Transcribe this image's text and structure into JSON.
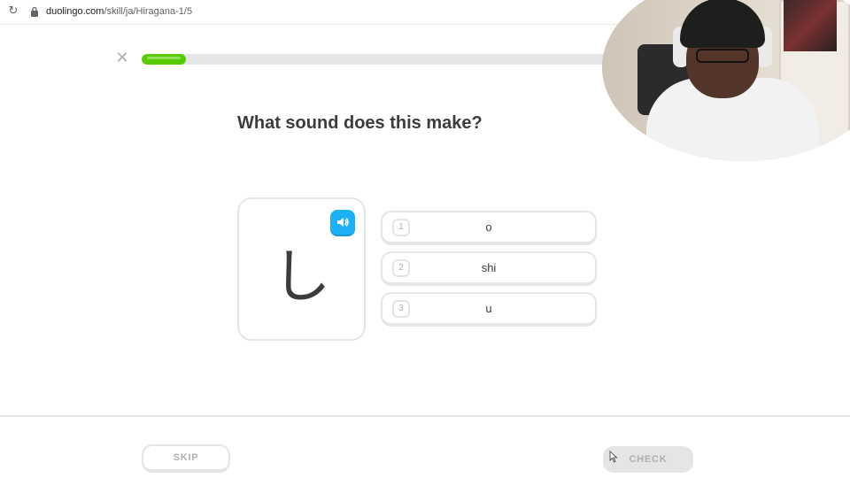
{
  "browser": {
    "url_host": "duolingo.com",
    "url_path": "/skill/ja/Hiragana-1/5"
  },
  "lesson": {
    "progress": 0.09,
    "question": "What sound does this make?",
    "character": "し",
    "options": [
      {
        "num": "1",
        "label": "o"
      },
      {
        "num": "2",
        "label": "shi"
      },
      {
        "num": "3",
        "label": "u"
      }
    ]
  },
  "footer": {
    "skip_label": "SKIP",
    "check_label": "CHECK"
  },
  "colors": {
    "accent_green": "#58cc02",
    "accent_blue": "#1cb0f6",
    "border_gray": "#e5e5e5",
    "muted_text": "#afafaf"
  },
  "icons": [
    "reload-icon",
    "lock-icon",
    "close-icon",
    "speaker-icon",
    "extension-icon",
    "cursor-icon"
  ]
}
